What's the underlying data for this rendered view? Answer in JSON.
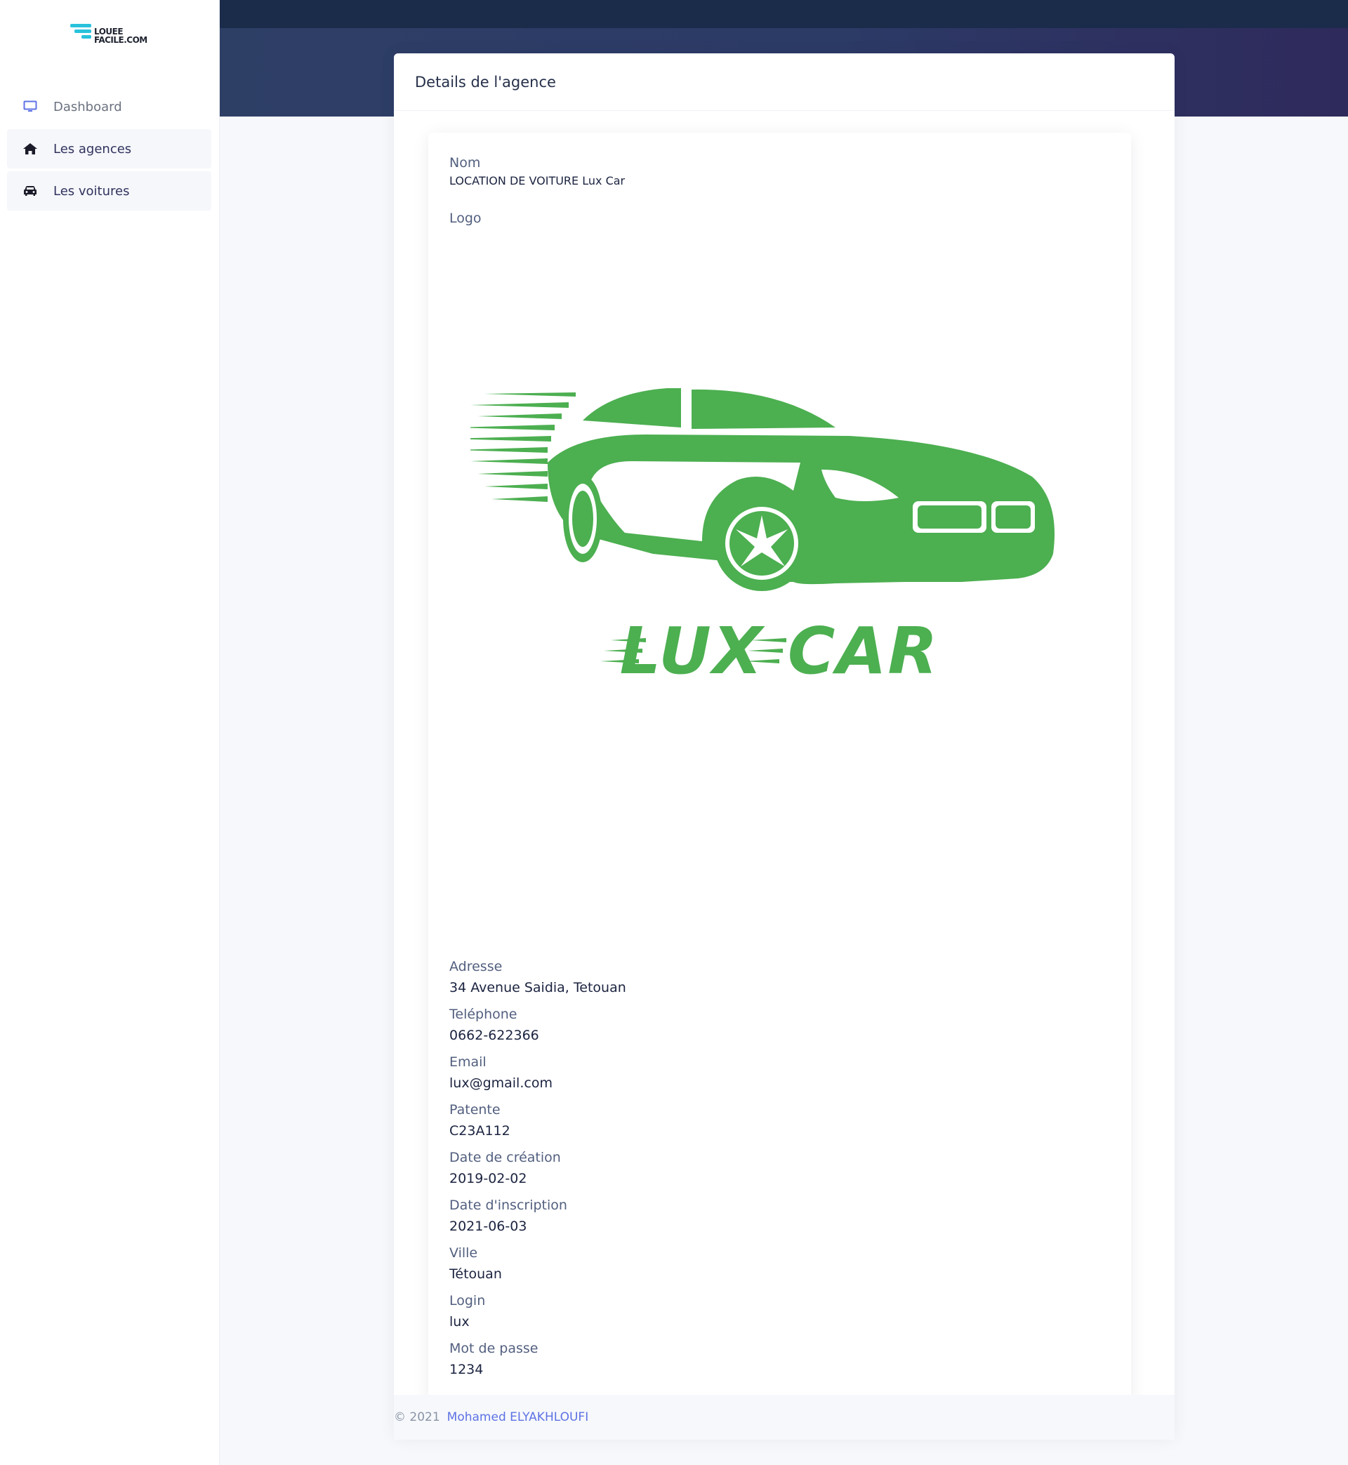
{
  "brand": {
    "line1": "LOUEE",
    "line2": "FACILE.COM",
    "color": "#29c2dc"
  },
  "sidebar": {
    "items": [
      {
        "label": "Dashboard",
        "icon": "monitor-icon"
      },
      {
        "label": "Les agences",
        "icon": "home-icon"
      },
      {
        "label": "Les voitures",
        "icon": "car-icon"
      }
    ]
  },
  "card": {
    "title": "Details de l'agence"
  },
  "agency": {
    "nom_label": "Nom",
    "nom": "LOCATION DE VOITURE Lux Car",
    "logo_label": "Logo",
    "logo_text": "LUX CAR",
    "logo_color": "#4caf50",
    "adresse_label": "Adresse",
    "adresse": "34 Avenue Saidia, Tetouan",
    "telephone_label": "Teléphone",
    "telephone": "0662-622366",
    "email_label": "Email",
    "email": "lux@gmail.com",
    "patente_label": "Patente",
    "patente": "C23A112",
    "date_creation_label": "Date de création",
    "date_creation": "2019-02-02",
    "date_inscription_label": "Date d'inscription",
    "date_inscription": "2021-06-03",
    "ville_label": "Ville",
    "ville": "Tétouan",
    "login_label": "Login",
    "login": "lux",
    "mdp_label": "Mot de passe",
    "mdp": "1234"
  },
  "footer": {
    "copyright": "© 2021",
    "author": "Mohamed ELYAKHLOUFI"
  }
}
